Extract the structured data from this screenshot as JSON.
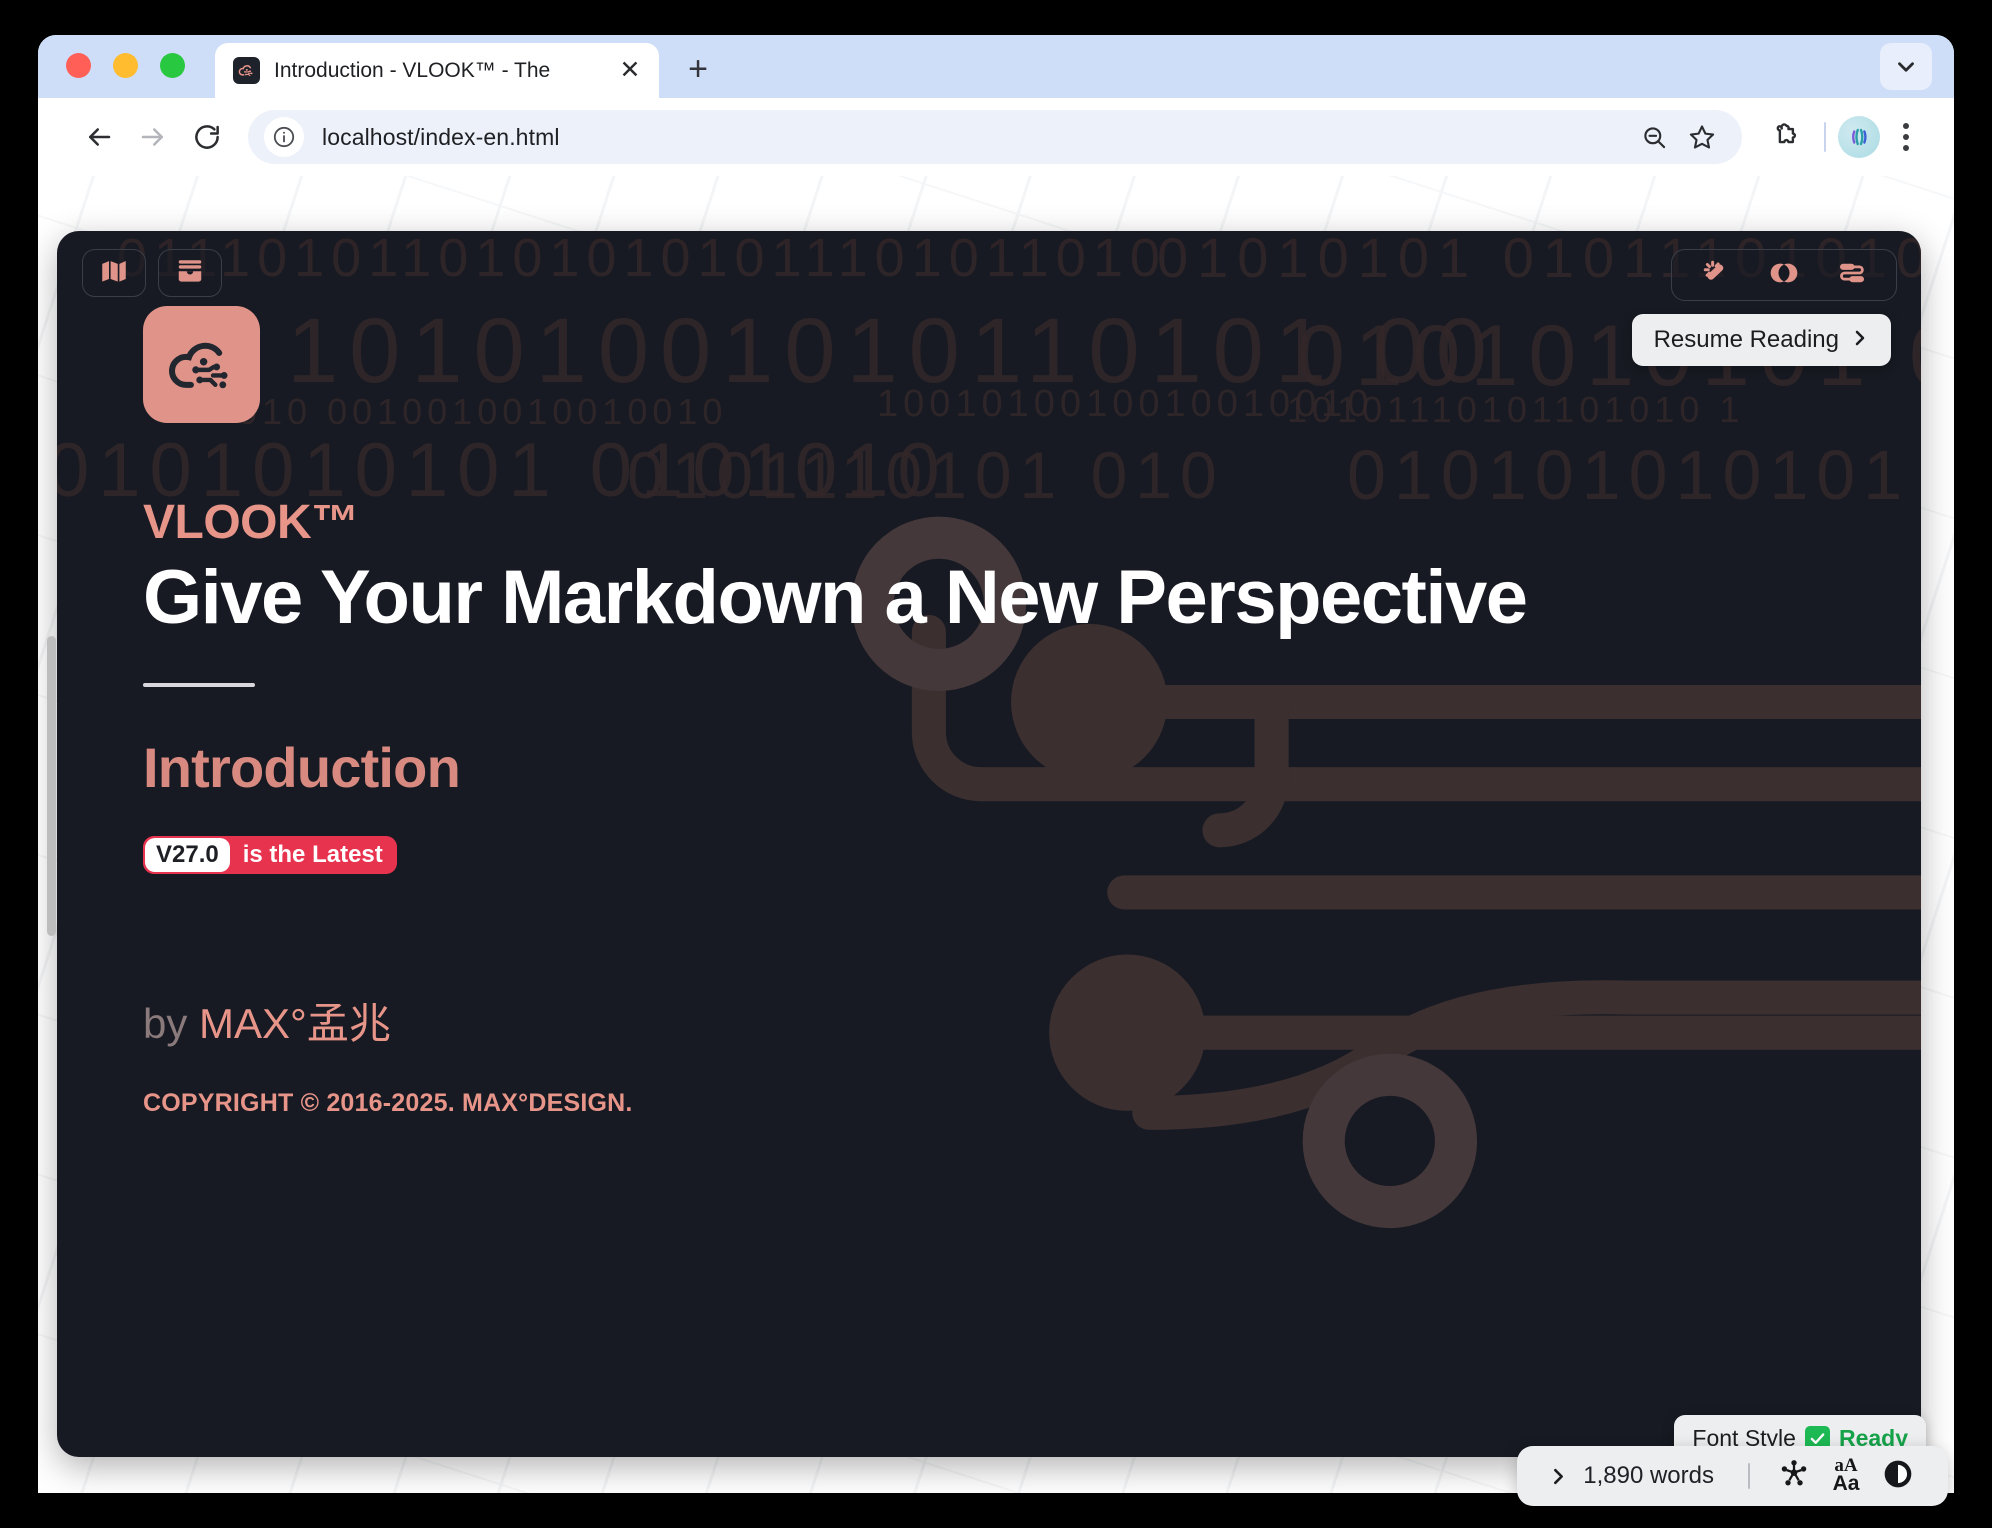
{
  "browser": {
    "tab": {
      "title": "Introduction - VLOOK™ - The",
      "favicon_icon": "vlook-cloud-icon",
      "close_icon": "close-icon"
    },
    "new_tab_label": "+",
    "tab_search_icon": "chevron-down-icon",
    "nav": {
      "back_icon": "arrow-left-icon",
      "forward_icon": "arrow-right-icon",
      "reload_icon": "reload-icon"
    },
    "omnibox": {
      "info_icon": "info-circle-icon",
      "url": "localhost/index-en.html",
      "zoom_out_icon": "zoom-out-icon",
      "bookmark_icon": "star-icon"
    },
    "toolbar": {
      "extensions_icon": "puzzle-extension-icon",
      "profile_icon": "profile-avatar-icon",
      "menu_icon": "kebab-menu-icon"
    }
  },
  "page": {
    "topbar_left": [
      {
        "name": "outline-map-button",
        "icon": "map-icon"
      },
      {
        "name": "card-stack-button",
        "icon": "card-stack-icon"
      }
    ],
    "topbar_right": [
      {
        "name": "magic-wand-button",
        "icon": "magic-wand-icon"
      },
      {
        "name": "theme-contrast-button",
        "icon": "venn-circles-icon"
      },
      {
        "name": "toggle-switch-button",
        "icon": "link-toggle-icon"
      }
    ],
    "resume_button": {
      "label": "Resume Reading",
      "icon": "chevron-right-icon"
    },
    "logo_icon": "vlook-cloud-logo",
    "brand": "VLOOK™",
    "title": "Give Your Markdown a New Perspective",
    "section": "Introduction",
    "badge": {
      "version": "V27.0",
      "text": "is the Latest"
    },
    "byline_prefix": "by ",
    "byline_author": "MAX°孟兆",
    "copyright": "COPYRIGHT © 2016-2025. MAX°DESIGN.",
    "binary_rows": [
      "01110101101010101011101011010",
      "10101001010110101 00",
      "010  0010010010010010",
      "01010101   01011101010101110100",
      "0101010101 01010",
      "10101110101101010 1",
      "0101010101 0101010",
      "1001010010010010010",
      "0101110101 010",
      "010101010101"
    ]
  },
  "toast": {
    "label": "Font Style",
    "check_icon": "green-check-icon",
    "status": "Ready"
  },
  "statusbar": {
    "expand_icon": "chevron-right-icon",
    "word_count": "1,890 words",
    "mindmap_icon": "hub-network-icon",
    "font_size_icon": "font-size-icon",
    "font_size_top": "aA",
    "font_size_bottom": "Aa",
    "contrast_icon": "contrast-toggle-icon"
  },
  "colors": {
    "accent": "#e79489",
    "badge": "#e8334f",
    "cover_bg": "#171a22",
    "tabstrip": "#cfdef8"
  }
}
